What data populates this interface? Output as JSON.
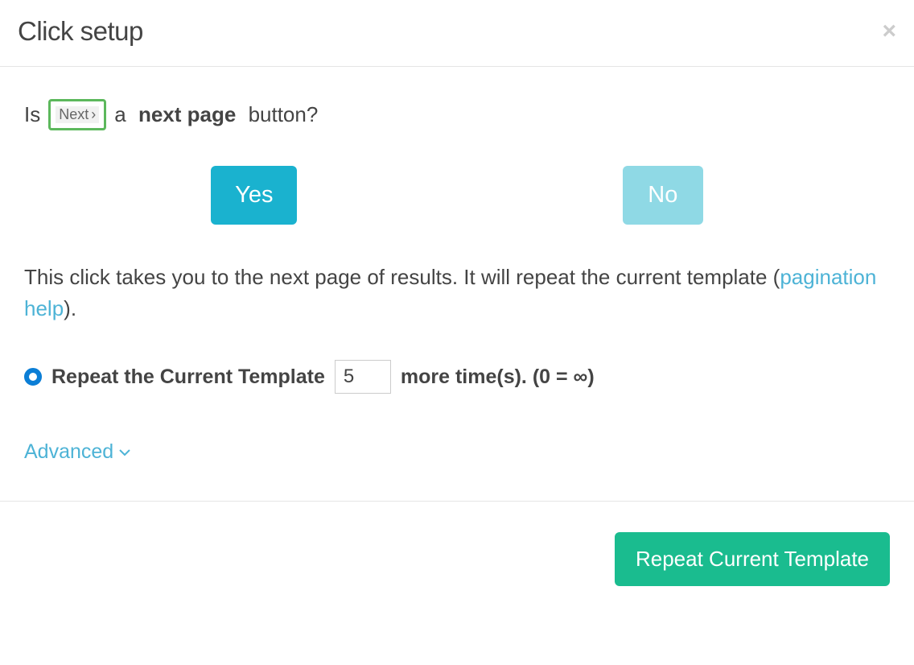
{
  "header": {
    "title": "Click setup"
  },
  "question": {
    "prefix": "Is",
    "chip_label": "Next",
    "chip_arrow": "›",
    "mid": "a",
    "bold": "next page",
    "suffix": "button?"
  },
  "buttons": {
    "yes": "Yes",
    "no": "No"
  },
  "description": {
    "text1": "This click takes you to the next page of results. It will repeat the current template (",
    "link": "pagination help",
    "text2": ")."
  },
  "repeat": {
    "label": "Repeat the Current Template",
    "value": "5",
    "suffix": "more time(s). (0 = ∞)"
  },
  "advanced": {
    "label": "Advanced"
  },
  "footer": {
    "repeat_button": "Repeat Current Template"
  }
}
